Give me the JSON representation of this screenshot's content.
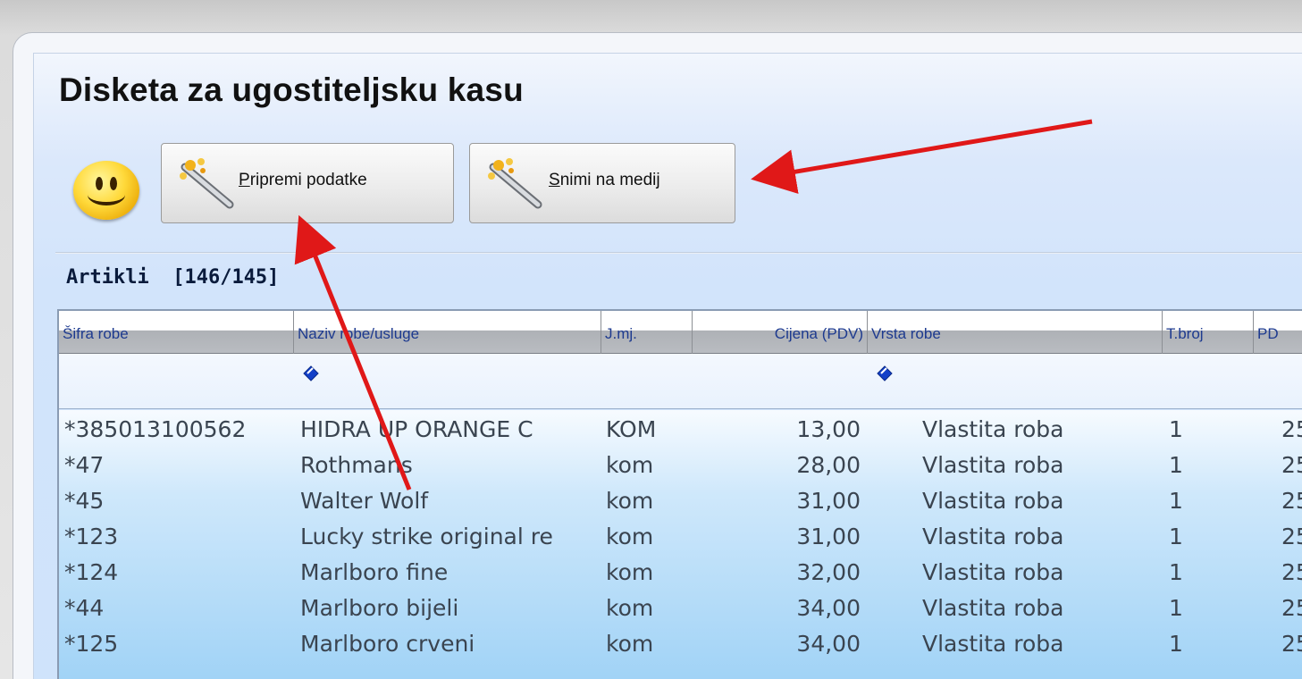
{
  "window": {
    "title": "Disketa za ugostiteljsku kasu"
  },
  "toolbar": {
    "prepare_button": {
      "accel": "P",
      "rest": "ripremi podatke",
      "icon": "magic-wand-icon"
    },
    "save_button": {
      "accel": "S",
      "rest": "nimi na medij",
      "icon": "magic-wand-icon"
    },
    "status_icon": "smiley-icon"
  },
  "section": {
    "label": "Artikli",
    "count": "[146/145]"
  },
  "grid": {
    "columns": [
      {
        "label": "Šifra robe"
      },
      {
        "label": "Naziv robe/usluge"
      },
      {
        "label": "J.mj."
      },
      {
        "label": "Cijena (PDV)"
      },
      {
        "label": "Vrsta robe"
      },
      {
        "label": "T.broj"
      },
      {
        "label": "PD"
      }
    ],
    "rows": [
      {
        "sifra": "*385013100562",
        "naziv": "HIDRA UP ORANGE C",
        "jmj": "KOM",
        "cijena": "13,00",
        "vrsta": "Vlastita roba",
        "tbroj": "1",
        "pd": "25"
      },
      {
        "sifra": "*47",
        "naziv": "Rothmans",
        "jmj": "kom",
        "cijena": "28,00",
        "vrsta": "Vlastita roba",
        "tbroj": "1",
        "pd": "25"
      },
      {
        "sifra": "*45",
        "naziv": "Walter Wolf",
        "jmj": "kom",
        "cijena": "31,00",
        "vrsta": "Vlastita roba",
        "tbroj": "1",
        "pd": "25"
      },
      {
        "sifra": "*123",
        "naziv": "Lucky strike original re",
        "jmj": "kom",
        "cijena": "31,00",
        "vrsta": "Vlastita roba",
        "tbroj": "1",
        "pd": "25"
      },
      {
        "sifra": "*124",
        "naziv": "Marlboro fine",
        "jmj": "kom",
        "cijena": "32,00",
        "vrsta": "Vlastita roba",
        "tbroj": "1",
        "pd": "25"
      },
      {
        "sifra": "*44",
        "naziv": "Marlboro bijeli",
        "jmj": "kom",
        "cijena": "34,00",
        "vrsta": "Vlastita roba",
        "tbroj": "1",
        "pd": "25"
      },
      {
        "sifra": "*125",
        "naziv": "Marlboro crveni",
        "jmj": "kom",
        "cijena": "34,00",
        "vrsta": "Vlastita roba",
        "tbroj": "1",
        "pd": "25"
      }
    ]
  },
  "annotations": {
    "arrow_color": "#e01818"
  }
}
